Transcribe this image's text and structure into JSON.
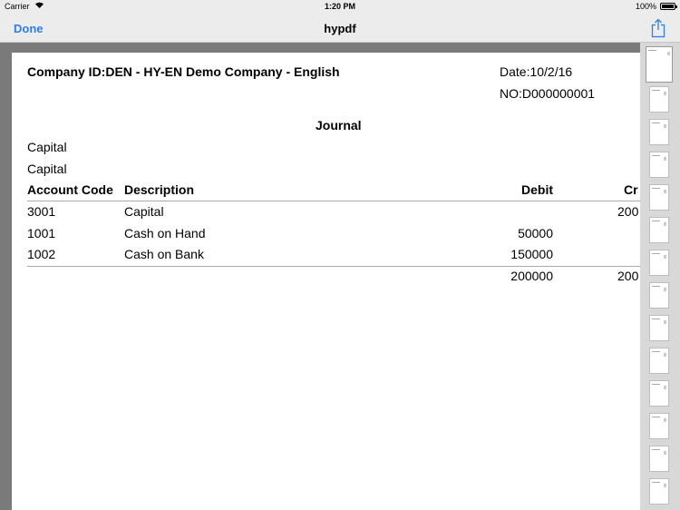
{
  "status_bar": {
    "carrier": "Carrier",
    "time": "1:20 PM",
    "battery": "100%"
  },
  "nav": {
    "done_label": "Done",
    "title": "hypdf"
  },
  "document": {
    "company": "Company ID:DEN - HY-EN Demo Company - English",
    "date": "Date:10/2/16",
    "number": "NO:D000000001",
    "heading": "Journal",
    "line1": "Capital",
    "line2": "Capital",
    "columns": {
      "account_code": "Account Code",
      "description": "Description",
      "debit": "Debit",
      "credit": "Cr"
    },
    "rows": [
      {
        "code": "3001",
        "description": "Capital",
        "debit": "",
        "credit": "200"
      },
      {
        "code": "1001",
        "description": "Cash on Hand",
        "debit": "50000",
        "credit": ""
      },
      {
        "code": "1002",
        "description": "Cash on Bank",
        "debit": "150000",
        "credit": ""
      }
    ],
    "totals": {
      "debit": "200000",
      "credit": "200"
    }
  }
}
